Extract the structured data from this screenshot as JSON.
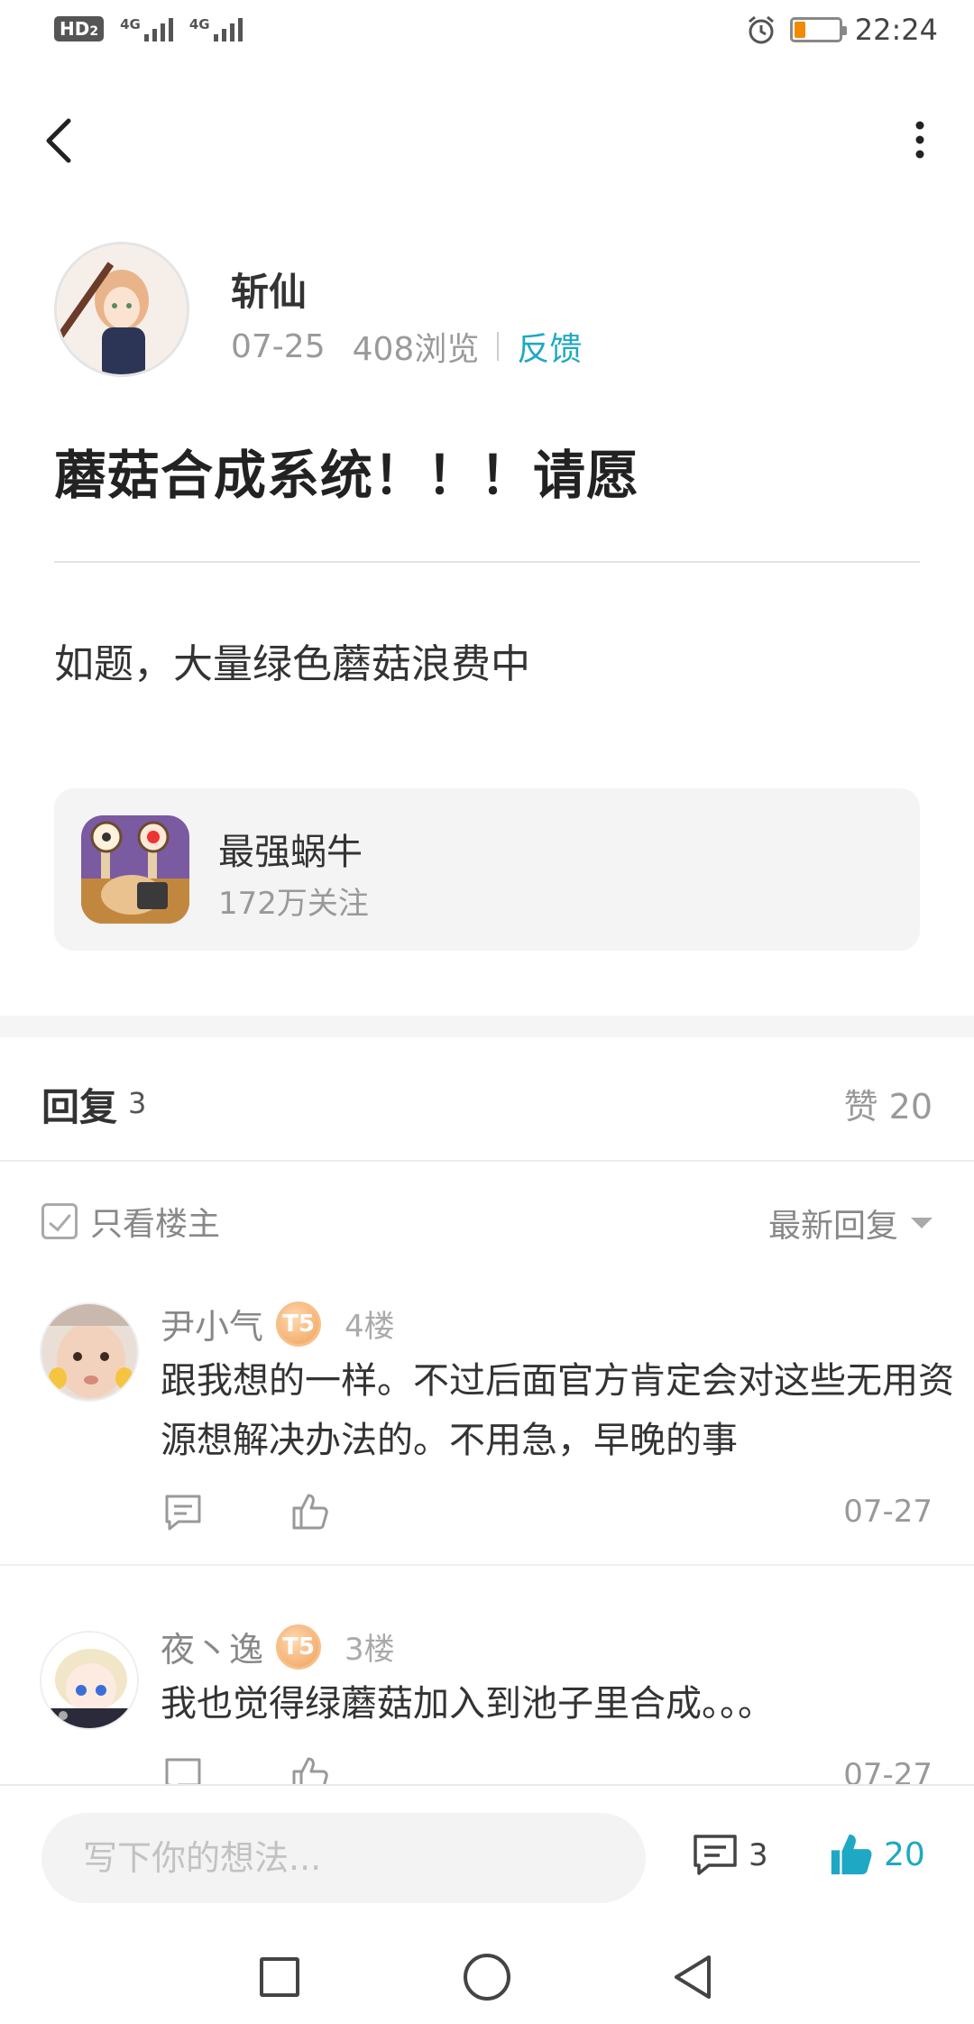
{
  "status_bar": {
    "hd": "HD",
    "hd_sub": "2",
    "net1": "4G",
    "net2": "4G",
    "time": "22:24"
  },
  "post": {
    "author_name": "斩仙",
    "date": "07-25",
    "views": "408浏览",
    "feedback": "反馈",
    "title": "蘑菇合成系统！！！请愿",
    "body": "如题，大量绿色蘑菇浪费中"
  },
  "game_card": {
    "name": "最强蜗牛",
    "followers": "172万关注"
  },
  "replies": {
    "label": "回复",
    "count": "3",
    "likes_label": "赞 20",
    "only_owner": "只看楼主",
    "sort": "最新回复"
  },
  "comments": [
    {
      "name": "尹小气",
      "level": "T5",
      "floor": "4楼",
      "text": "跟我想的一样。不过后面官方肯定会对这些无用资源想解决办法的。不用急，早晚的事",
      "date": "07-27"
    },
    {
      "name": "夜丶逸",
      "level": "T5",
      "floor": "3楼",
      "text": "我也觉得绿蘑菇加入到池子里合成。。。",
      "date": "07-27"
    }
  ],
  "bottom_bar": {
    "input_placeholder": "写下你的想法...",
    "comment_count": "3",
    "like_count": "20"
  },
  "colors": {
    "accent": "#1fa8c4",
    "battery": "#f08a00"
  }
}
